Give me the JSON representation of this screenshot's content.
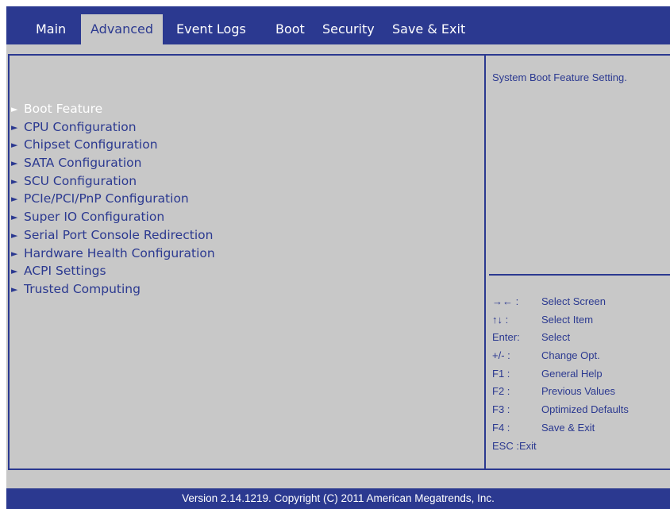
{
  "tabs": [
    {
      "label": "Main"
    },
    {
      "label": "Advanced"
    },
    {
      "label": "Event Logs"
    },
    {
      "label": "Boot"
    },
    {
      "label": "Security"
    },
    {
      "label": "Save & Exit"
    }
  ],
  "active_tab": "Advanced",
  "menu_items": [
    {
      "label": "Boot Feature",
      "selected": true
    },
    {
      "label": "CPU Configuration"
    },
    {
      "label": "Chipset Configuration"
    },
    {
      "label": "SATA Configuration"
    },
    {
      "label": "SCU Configuration"
    },
    {
      "label": "PCIe/PCI/PnP Configuration"
    },
    {
      "label": "Super IO Configuration"
    },
    {
      "label": "Serial Port Console Redirection"
    },
    {
      "label": "Hardware Health Configuration"
    },
    {
      "label": "ACPI Settings"
    },
    {
      "label": "Trusted Computing"
    }
  ],
  "menu_arrow": "►",
  "help": {
    "description": "System Boot Feature Setting.",
    "keys": [
      {
        "key": "→←  :",
        "desc": "Select Screen"
      },
      {
        "key": "↑↓  :",
        "desc": "Select Item"
      },
      {
        "key": "Enter:",
        "desc": "Select"
      },
      {
        "key": "+/-  :",
        "desc": "Change Opt."
      },
      {
        "key": "F1 :",
        "desc": "General Help"
      },
      {
        "key": "F2 :",
        "desc": "Previous Values"
      },
      {
        "key": "F3 :",
        "desc": "Optimized Defaults"
      },
      {
        "key": "F4 :",
        "desc": "Save & Exit"
      },
      {
        "key": "ESC :Exit",
        "desc": ""
      }
    ]
  },
  "footer": "Version 2.14.1219. Copyright (C) 2011 American Megatrends, Inc.",
  "colors": {
    "primary": "#2b3990",
    "panel": "#c8c8c8",
    "selected_text": "#ffffff"
  }
}
